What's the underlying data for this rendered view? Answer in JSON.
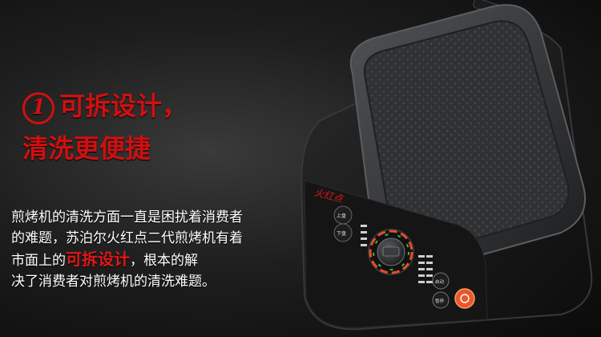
{
  "headline": {
    "number": "1",
    "line1": "可拆设计，",
    "line2": "清洗更便捷"
  },
  "description": {
    "line1": "煎烤机的清洗方面一直是困扰着消费者",
    "line2": "的难题，苏泊尔火红点二代煎烤机有着",
    "line3_before": "市面上的",
    "line3_highlight": "可拆设计",
    "line3_after": "，根本的解",
    "line4": "决了消费者对煎烤机的清洗难题。"
  },
  "product": {
    "brand_logo": "火红点",
    "buttons": [
      "上盘",
      "下盘",
      "启动",
      "暂停"
    ],
    "accent_color": "#e8582a",
    "highlight_color": "#e01818"
  }
}
